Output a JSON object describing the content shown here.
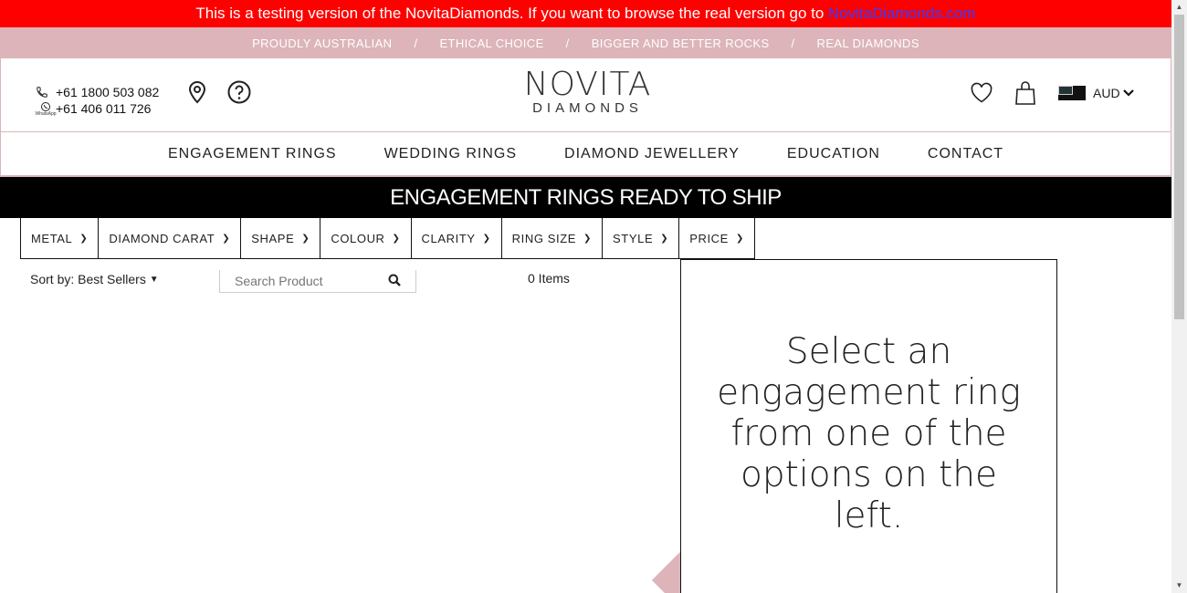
{
  "test_banner": {
    "text": "This is a testing version of the NovitaDiamonds. If you want to browse the real version go to ",
    "link": "NovitaDiamonds.com"
  },
  "promo": [
    "PROUDLY AUSTRALIAN",
    "ETHICAL CHOICE",
    "BIGGER AND BETTER ROCKS",
    "REAL DIAMONDS"
  ],
  "promo_separator": "/",
  "contact": {
    "phone": "+61 1800 503 082",
    "whatsapp": "+61 406 011 726",
    "whatsapp_label": "WhatsApp"
  },
  "logo": {
    "line1": "NOVITA",
    "line2": "DIAMONDS"
  },
  "currency": {
    "code": "AUD"
  },
  "nav": [
    "ENGAGEMENT RINGS",
    "WEDDING RINGS",
    "DIAMOND JEWELLERY",
    "EDUCATION",
    "CONTACT"
  ],
  "page_title": "ENGAGEMENT RINGS READY TO SHIP",
  "filters": [
    "METAL",
    "DIAMOND CARAT",
    "SHAPE",
    "COLOUR",
    "CLARITY",
    "RING SIZE",
    "STYLE",
    "PRICE"
  ],
  "sort": {
    "label": "Sort by: Best Sellers"
  },
  "search": {
    "placeholder": "Search Product"
  },
  "items_count": "0 Items",
  "select_prompt": "Select an engagement ring from one of the options on the left.",
  "colors": {
    "banner": "#ff0000",
    "promo": "#dcb4b9",
    "title_bar": "#000000",
    "link": "#3b3bff"
  }
}
